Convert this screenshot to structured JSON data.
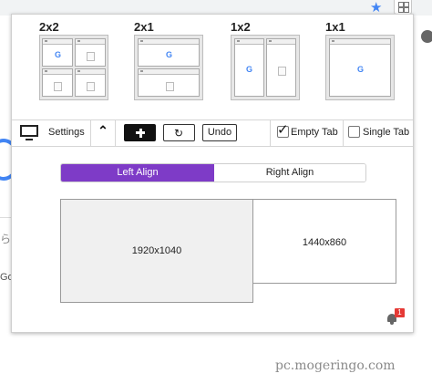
{
  "browser": {
    "bookmark_icon": "star-icon",
    "extension_icon": "grid-icon"
  },
  "popup": {
    "layouts": [
      {
        "label": "2x2"
      },
      {
        "label": "2x1"
      },
      {
        "label": "1x2"
      },
      {
        "label": "1x1"
      }
    ],
    "toolbar": {
      "monitor_icon": "monitor-icon",
      "settings_label": "Settings",
      "collapse_icon": "chevron-up-icon",
      "add_icon": "plus-icon",
      "refresh_icon": "refresh-icon",
      "undo_label": "Undo",
      "empty_tab_label": "Empty Tab",
      "empty_tab_checked": true,
      "single_tab_label": "Single Tab",
      "single_tab_checked": false
    },
    "align": {
      "left_label": "Left Align",
      "right_label": "Right Align",
      "selected": "left"
    },
    "monitors": [
      {
        "label": "1920x1040",
        "selected": true
      },
      {
        "label": "1440x860",
        "selected": false
      }
    ],
    "notifications": {
      "icon": "bell-icon",
      "count": "1"
    }
  },
  "watermark": "pc.mogeringo.com",
  "colors": {
    "accent": "#7e3bc7",
    "badge": "#e53935",
    "google_blue": "#4285f4"
  }
}
